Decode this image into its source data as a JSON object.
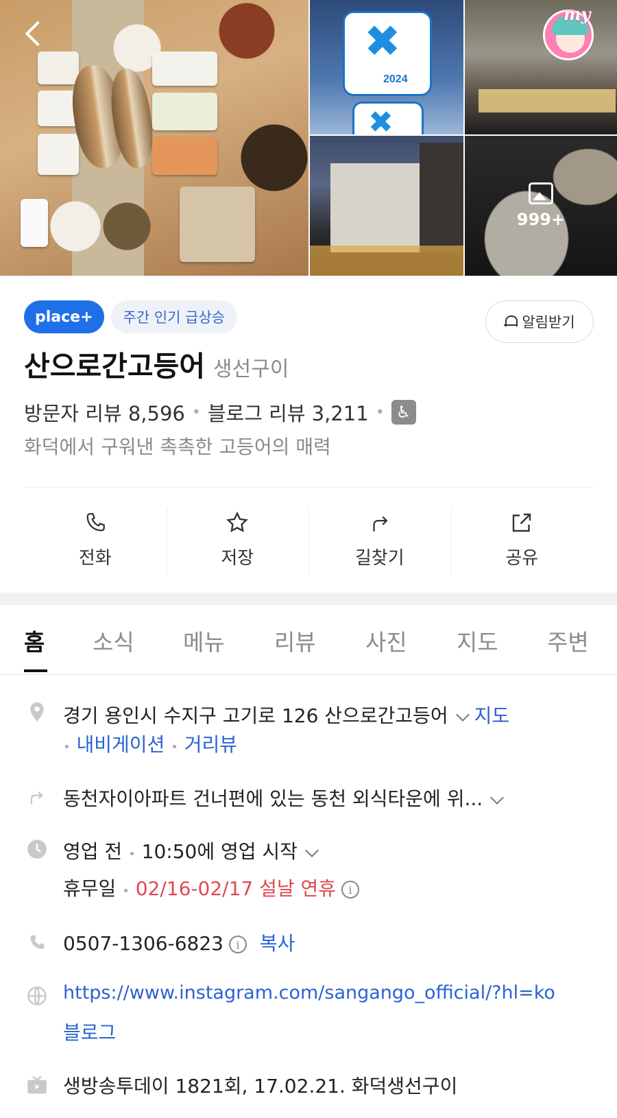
{
  "gallery": {
    "ribbon_year": "2024",
    "more_count": "999+",
    "my_label": "my"
  },
  "header": {
    "badge_place": "place+",
    "badge_trend": "주간 인기 급상승",
    "notify_label": "알림받기"
  },
  "place": {
    "name": "산으로간고등어",
    "category": "생선구이",
    "visitor_reviews": "방문자 리뷰 8,596",
    "blog_reviews": "블로그 리뷰 3,211",
    "tagline": "화덕에서 구워낸 촉촉한 고등어의 매력"
  },
  "actions": [
    {
      "label": "전화",
      "icon": "phone-icon"
    },
    {
      "label": "저장",
      "icon": "star-icon"
    },
    {
      "label": "길찾기",
      "icon": "directions-icon"
    },
    {
      "label": "공유",
      "icon": "share-icon"
    }
  ],
  "tabs": [
    "홈",
    "소식",
    "메뉴",
    "리뷰",
    "사진",
    "지도",
    "주변"
  ],
  "details": {
    "address": "경기 용인시 수지구 고기로 126 산으로간고등어",
    "map_link": "지도",
    "navigation_link": "내비게이션",
    "street_view_link": "거리뷰",
    "directions_text": "동천자이아파트 건너편에 있는 동천 외식타운에 위...",
    "hours_status": "영업 전",
    "hours_start": "10:50에 영업 시작",
    "closed_label": "휴무일",
    "closed_dates": "02/16-02/17 설날 연휴",
    "phone": "0507-1306-6823",
    "copy_label": "복사",
    "website": "https://www.instagram.com/sangango_official/?hl=ko",
    "blog_link": "블로그",
    "tv_info": "생방송투데이 1821회, 17.02.21. 화덕생선구이"
  },
  "colors": {
    "brand_blue": "#1f6fe9",
    "link_blue": "#2a62d2",
    "holiday_red": "#e0484f"
  }
}
